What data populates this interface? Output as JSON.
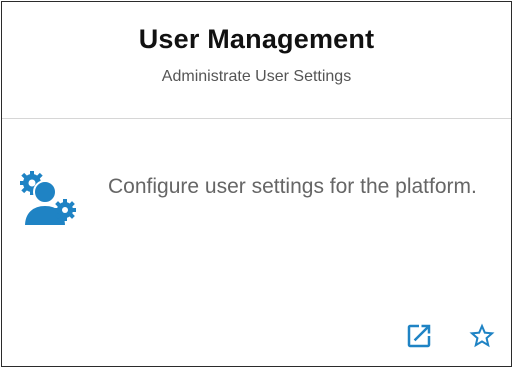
{
  "card": {
    "title": "User Management",
    "subtitle": "Administrate User Settings",
    "description": "Configure user settings for the platform.",
    "icon": "users-gear-icon",
    "actions": [
      {
        "name": "open-external",
        "icon": "open-in-new-icon"
      },
      {
        "name": "favorite",
        "icon": "star-outline-icon"
      }
    ]
  },
  "colors": {
    "accent": "#1f83c4",
    "title": "#111111",
    "subtitle": "#555555",
    "description": "#666666",
    "divider": "#d6d6d6"
  }
}
